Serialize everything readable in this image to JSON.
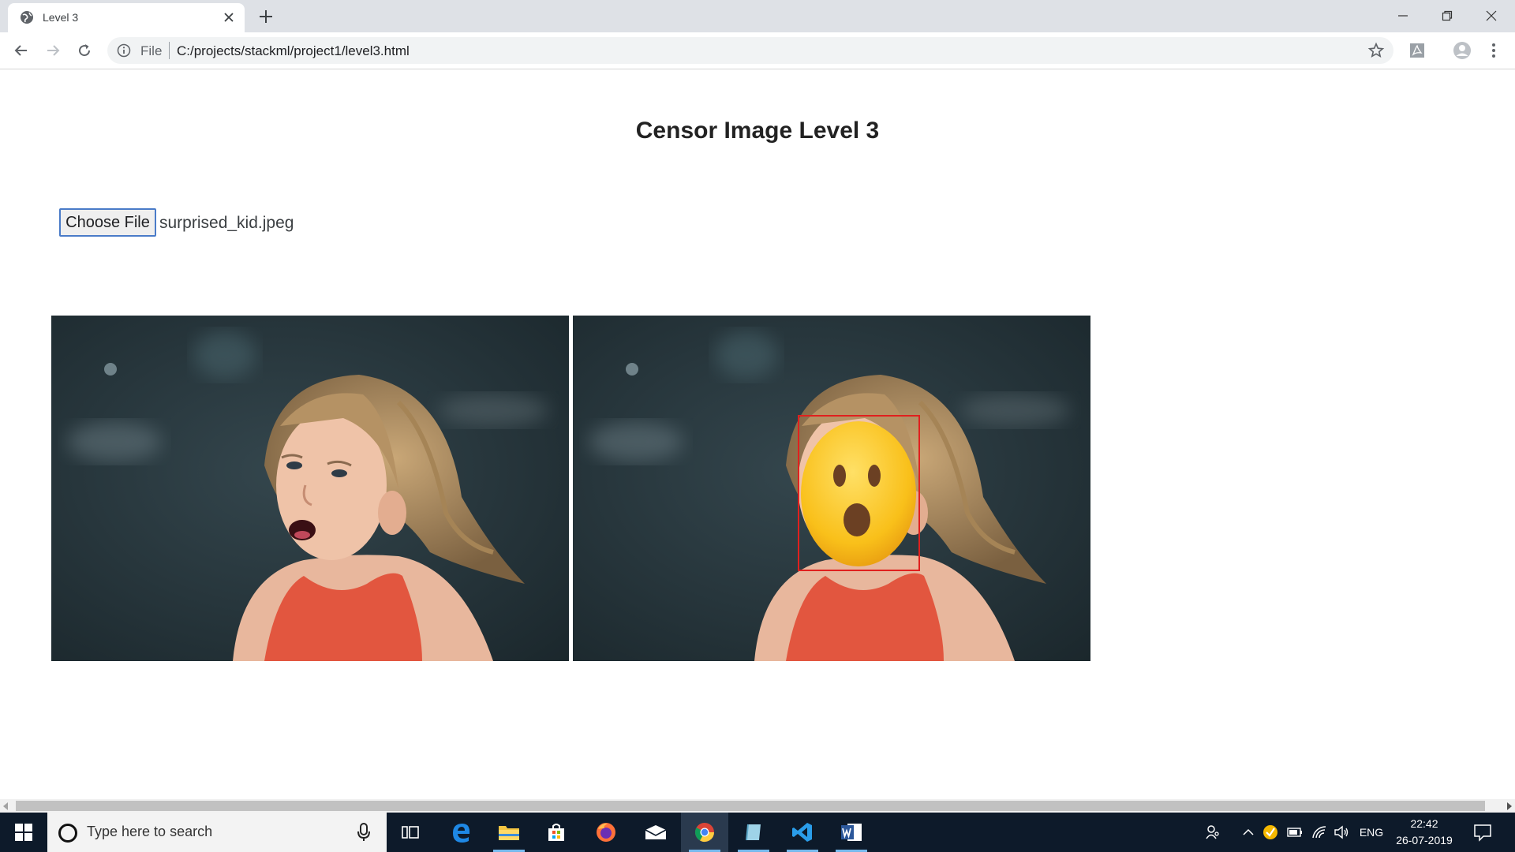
{
  "browser": {
    "tab_title": "Level 3",
    "scheme_label": "File",
    "url": "C:/projects/stackml/project1/level3.html"
  },
  "page": {
    "title": "Censor Image Level 3",
    "file_button_label": "Choose File",
    "file_name": "surprised_kid.jpeg"
  },
  "taskbar": {
    "search_placeholder": "Type here to search",
    "language": "ENG",
    "time": "22:42",
    "date": "26-07-2019",
    "apps": [
      "task-view",
      "edge",
      "file-explorer",
      "store",
      "firefox",
      "mail",
      "chrome",
      "app-blue",
      "vscode",
      "word"
    ]
  },
  "colors": {
    "accent": "#4a7bc8",
    "taskbar": "#0d1a2a",
    "face_box": "#e0201e",
    "emoji": "#f9c01a"
  }
}
